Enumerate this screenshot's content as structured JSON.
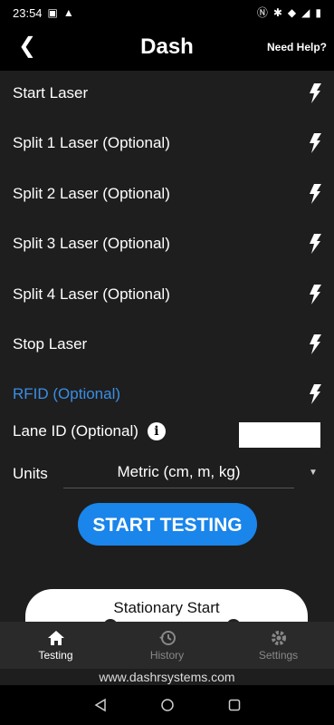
{
  "status": {
    "time": "23:54"
  },
  "header": {
    "title": "Dash",
    "help": "Need Help?"
  },
  "lasers": [
    {
      "label": "Start Laser"
    },
    {
      "label": "Split 1 Laser (Optional)"
    },
    {
      "label": "Split 2 Laser (Optional)"
    },
    {
      "label": "Split 3 Laser (Optional)"
    },
    {
      "label": "Split 4 Laser (Optional)"
    },
    {
      "label": "Stop Laser"
    },
    {
      "label": "RFID (Optional)"
    }
  ],
  "lane": {
    "label": "Lane ID (Optional)",
    "value": ""
  },
  "units": {
    "label": "Units",
    "selected": "Metric (cm, m, kg)"
  },
  "start_button": "START TESTING",
  "stationary": {
    "label": "Stationary Start"
  },
  "tabs": [
    {
      "label": "Testing",
      "icon": "home-icon",
      "active": true
    },
    {
      "label": "History",
      "icon": "history-icon",
      "active": false
    },
    {
      "label": "Settings",
      "icon": "gear-icon",
      "active": false
    }
  ],
  "footer": "www.dashrsystems.com",
  "colors": {
    "accent": "#1a85ea",
    "rfid": "#3a8ee6",
    "background": "#1e1e1e"
  }
}
